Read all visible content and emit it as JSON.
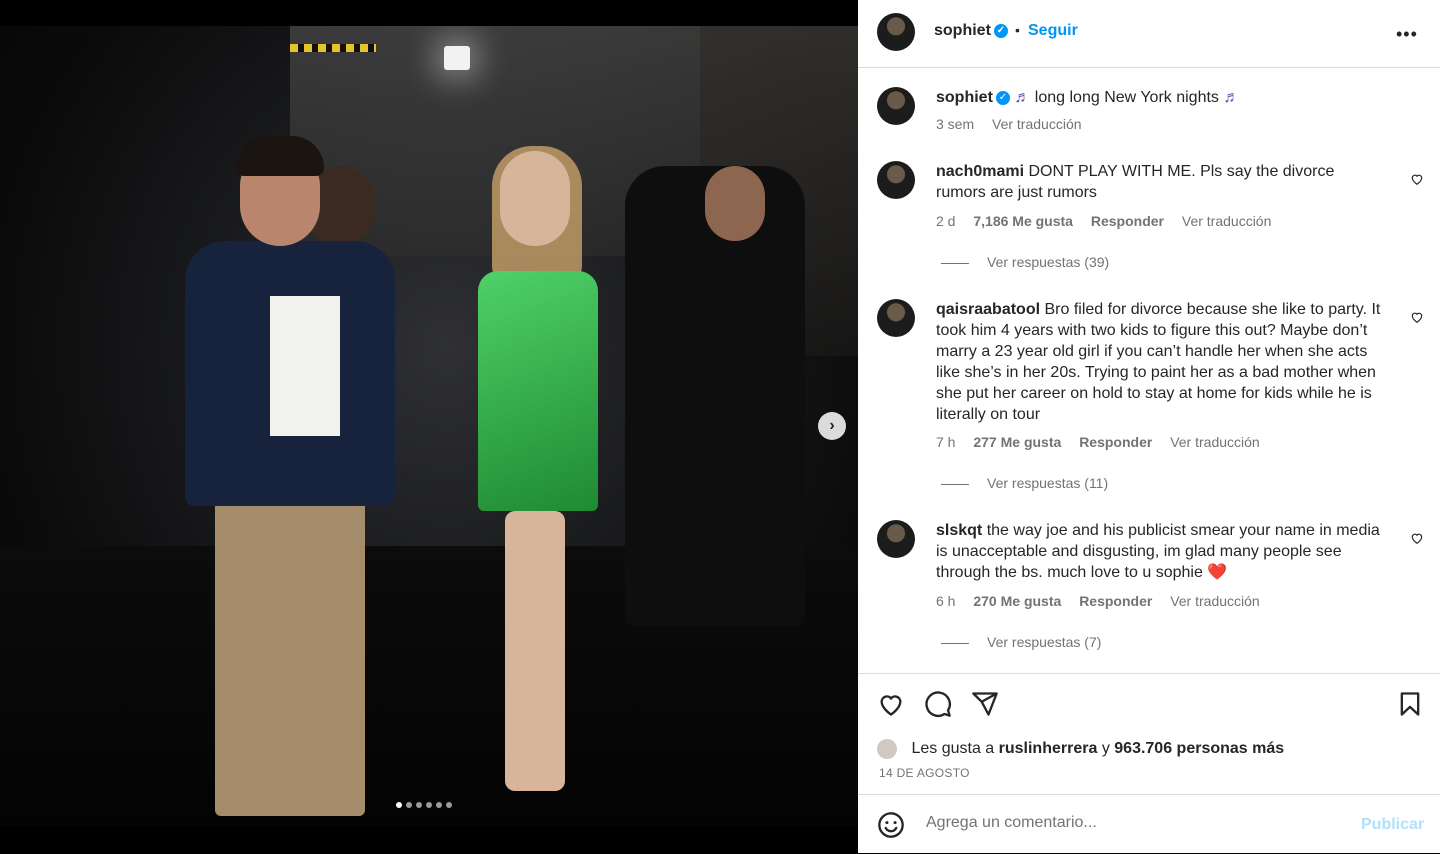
{
  "header": {
    "username": "sophiet",
    "separator": "•",
    "follow_label": "Seguir",
    "more_label": "•••"
  },
  "caption": {
    "username": "sophiet",
    "note": "♬",
    "text": "long long New York nights",
    "time": "3 sem",
    "translate": "Ver traducción"
  },
  "comments": [
    {
      "username": "nach0mami",
      "text": "DONT PLAY WITH ME. Pls say the divorce rumors are just rumors",
      "time": "2 d",
      "likes": "7,186 Me gusta",
      "reply": "Responder",
      "translate": "Ver traducción",
      "replies": "Ver respuestas (39)"
    },
    {
      "username": "qaisraabatool",
      "text": "Bro filed for divorce because she like to party. It took him 4 years with two kids to figure this out? Maybe don’t marry a 23 year old girl if you can’t handle her when she acts like she’s in her 20s. Trying to paint her as a bad mother when she put her career on hold to stay at home for kids while he is literally on tour",
      "time": "7 h",
      "likes": "277 Me gusta",
      "reply": "Responder",
      "translate": "Ver traducción",
      "replies": "Ver respuestas (11)"
    },
    {
      "username": "slskqt",
      "text": "the way joe and his publicist smear your name in media is unacceptable and disgusting, im glad many people see through the bs. much love to u sophie",
      "emoji": "❤️",
      "time": "6 h",
      "likes": "270 Me gusta",
      "reply": "Responder",
      "translate": "Ver traducción",
      "replies": "Ver respuestas (7)"
    }
  ],
  "likes": {
    "prefix": "Les gusta a",
    "user": "ruslinherrera",
    "middle": "y",
    "others": "963.706 personas más"
  },
  "date": "14 DE AGOSTO",
  "comment_box": {
    "placeholder": "Agrega un comentario...",
    "publish": "Publicar"
  },
  "carousel": {
    "total": 6,
    "active": 1
  },
  "icons": [
    "heart-icon",
    "comment-icon",
    "share-icon",
    "save-icon",
    "emoji-icon",
    "chevron-right-icon",
    "verified-icon",
    "music-note-icon"
  ],
  "colors": {
    "link": "#0095f6",
    "verified": "#0095f6",
    "publish_disabled": "#b2dffc",
    "muted": "#737373"
  }
}
